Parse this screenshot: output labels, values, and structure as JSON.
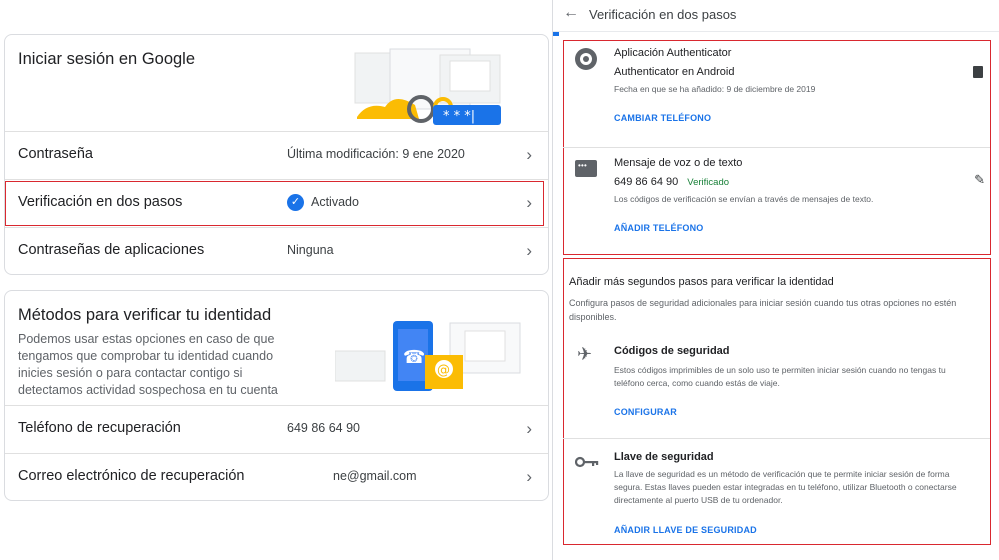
{
  "left": {
    "signin_card": {
      "title": "Iniciar sesión en Google",
      "rows": [
        {
          "label": "Contraseña",
          "value": "Última modificación: 9 ene 2020"
        },
        {
          "label": "Verificación en dos pasos",
          "value": "Activado"
        },
        {
          "label": "Contraseñas de aplicaciones",
          "value": "Ninguna"
        }
      ]
    },
    "identity_card": {
      "title": "Métodos para verificar tu identidad",
      "description": "Podemos usar estas opciones en caso de que tengamos que comprobar tu identidad cuando inicies sesión o para contactar contigo si detectamos actividad sospechosa en tu cuenta",
      "rows": [
        {
          "label": "Teléfono de recuperación",
          "value": "649 86 64 90"
        },
        {
          "label": "Correo electrónico de recuperación",
          "value": "ne@gmail.com"
        }
      ]
    }
  },
  "right": {
    "header": {
      "title": "Verificación en dos pasos",
      "back_icon": "arrow-left-icon"
    },
    "authenticator": {
      "title": "Aplicación Authenticator",
      "subtitle": "Authenticator en Android",
      "date": "Fecha en que se ha añadido: 9 de diciembre de 2019",
      "link": "CAMBIAR TELÉFONO"
    },
    "voice_text": {
      "title": "Mensaje de voz o de texto",
      "phone": "649 86 64 90",
      "status": "Verificado",
      "note": "Los códigos de verificación se envían a través de mensajes de texto.",
      "link": "AÑADIR TELÉFONO"
    },
    "more_steps": {
      "title": "Añadir más segundos pasos para verificar la identidad",
      "description": "Configura pasos de seguridad adicionales para iniciar sesión cuando tus otras opciones no estén disponibles."
    },
    "security_codes": {
      "title": "Códigos de seguridad",
      "description": "Estos códigos imprimibles de un solo uso te permiten iniciar sesión cuando no tengas tu teléfono cerca, como cuando estás de viaje.",
      "link": "CONFIGURAR"
    },
    "security_key": {
      "title": "Llave de seguridad",
      "description": "La llave de seguridad es un método de verificación que te permite iniciar sesión de forma segura. Estas llaves pueden estar integradas en tu teléfono, utilizar Bluetooth o conectarse directamente al puerto USB de tu ordenador.",
      "link": "AÑADIR LLAVE DE SEGURIDAD"
    }
  },
  "colors": {
    "accent": "#1a73e8",
    "highlight_box": "#d9282f",
    "verified": "#188038"
  }
}
